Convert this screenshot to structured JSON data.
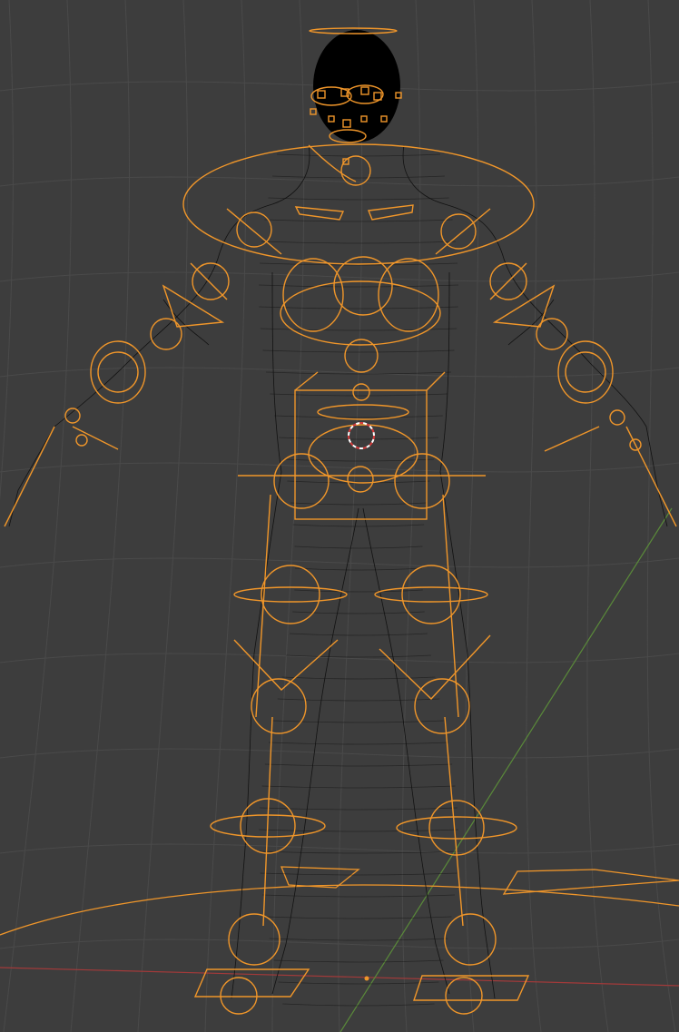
{
  "viewport": {
    "mode": "wireframe",
    "subject": "character-armature",
    "colors": {
      "background": "#3d3d3d",
      "grid": "#4a4a4a",
      "mesh": "#121212",
      "rig": "#f0962a",
      "x_axis": "#a33a3a",
      "y_axis": "#5a8a3a",
      "cursor_red": "#d63a3a",
      "cursor_white": "#ffffff"
    },
    "icons": [
      "3d-cursor-icon",
      "origin-icon"
    ]
  }
}
